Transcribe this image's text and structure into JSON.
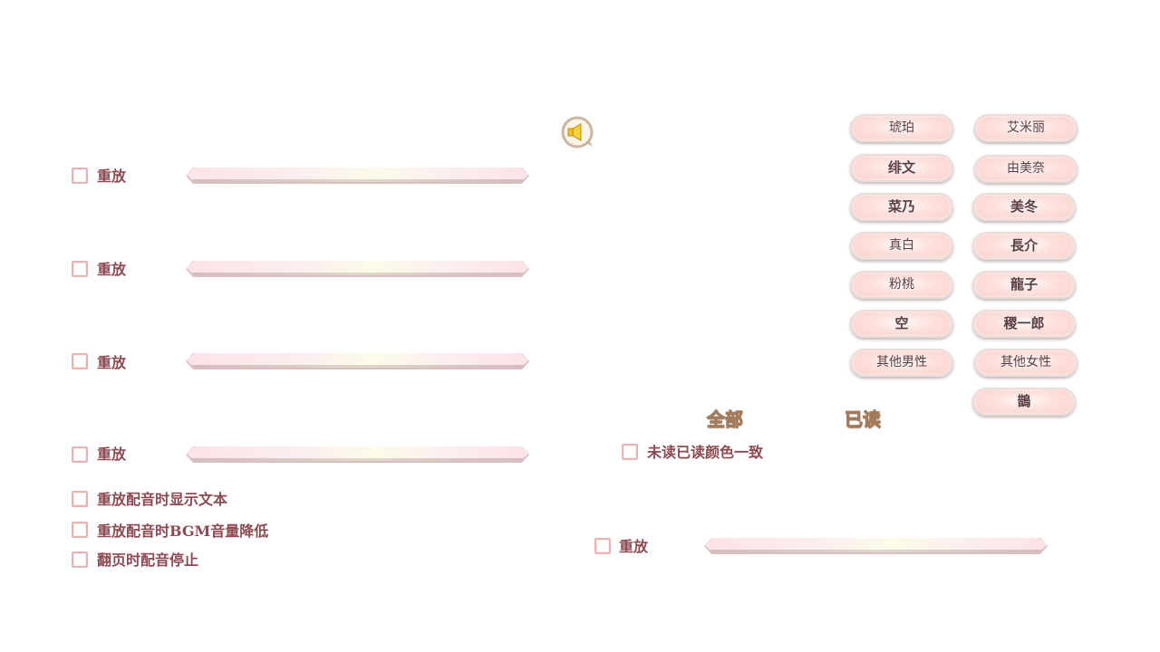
{
  "left_panel": {
    "replay_rows": [
      {
        "label": "重放"
      },
      {
        "label": "重放"
      },
      {
        "label": "重放"
      },
      {
        "label": "重放"
      }
    ],
    "options": [
      {
        "label": "重放配音时显示文本"
      },
      {
        "label": "重放配音时BGM音量降低"
      },
      {
        "label": "翻页时配音停止"
      }
    ]
  },
  "speaker": {
    "icon": "speaker-icon"
  },
  "characters": [
    {
      "label": "琥珀",
      "bold": false
    },
    {
      "label": "艾米丽",
      "bold": false
    },
    {
      "label": "绯文",
      "bold": true
    },
    {
      "label": "由美奈",
      "bold": false
    },
    {
      "label": "菜乃",
      "bold": true
    },
    {
      "label": "美冬",
      "bold": true
    },
    {
      "label": "真白",
      "bold": false
    },
    {
      "label": "長介",
      "bold": true
    },
    {
      "label": "粉桃",
      "bold": false
    },
    {
      "label": "龍子",
      "bold": true
    },
    {
      "label": "空",
      "bold": true
    },
    {
      "label": "稷一郎",
      "bold": true
    },
    {
      "label": "其他男性",
      "bold": false
    },
    {
      "label": "其他女性",
      "bold": false
    },
    {
      "label": "鵲",
      "bold": true
    }
  ],
  "tabs": {
    "all": "全部",
    "read": "已读"
  },
  "read_color_option": {
    "label": "未读已读颜色一致"
  },
  "right_replay": {
    "label": "重放"
  },
  "colors": {
    "label_text": "#8c4a52",
    "checkbox_border": "#e9b3b3",
    "button_fill": "#fbd2cc",
    "tab_outline": "#a27a5c"
  }
}
